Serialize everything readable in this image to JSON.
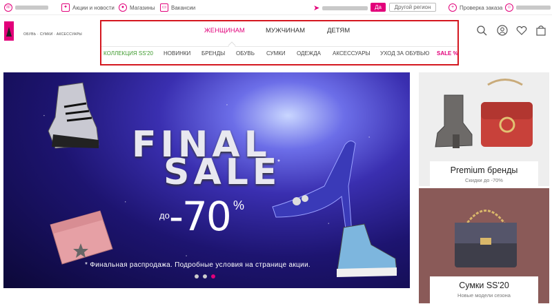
{
  "topbar": {
    "phone_redacted": "",
    "promo_label": "Акции и новости",
    "stores_label": "Магазины",
    "jobs_label": "Вакансии",
    "region_redacted": "",
    "yes_label": "Да",
    "other_region_label": "Другой регион",
    "check_order_label": "Проверка заказа",
    "account_redacted": ""
  },
  "brand": {
    "tagline": "ОБУВЬ · СУМКИ · АКСЕССУАРЫ"
  },
  "main_nav": [
    "ЖЕНЩИНАМ",
    "МУЖЧИНАМ",
    "ДЕТЯМ"
  ],
  "sub_nav": [
    "КОЛЛЕКЦИЯ SS'20",
    "НОВИНКИ",
    "БРЕНДЫ",
    "ОБУВЬ",
    "СУМКИ",
    "ОДЕЖДА",
    "АКСЕССУАРЫ",
    "УХОД ЗА ОБУВЬЮ",
    "SALE %"
  ],
  "hero": {
    "line1": "FINAL",
    "line2": "SALE",
    "asterisk": "*",
    "prefix": "до",
    "discount": "-70",
    "percent": "%",
    "caption": "* Финальная распродажа. Подробные условия на странице акции.",
    "slides": 3,
    "active_slide": 3
  },
  "promo_cards": [
    {
      "title": "Premium бренды",
      "subtitle": "Скидки до -70%"
    },
    {
      "title": "Сумки SS'20",
      "subtitle": "Новые модели сезона"
    }
  ],
  "colors": {
    "accent": "#e2007a",
    "highlight_box": "#d4161e",
    "collection_green": "#3f9b2e"
  }
}
